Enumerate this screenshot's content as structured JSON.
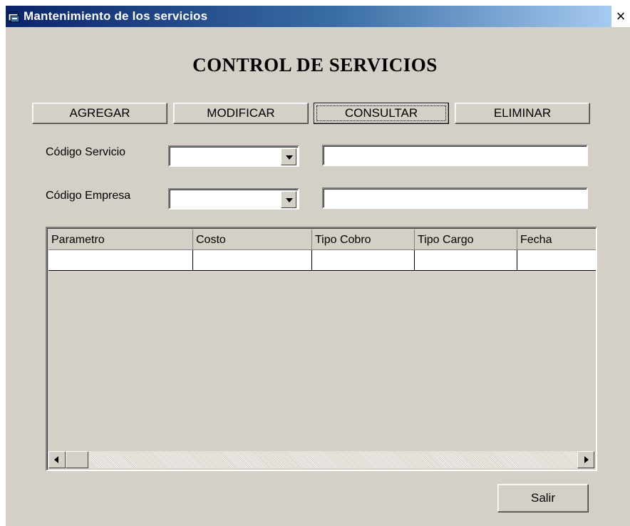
{
  "window": {
    "title": "Mantenimiento de los servicios",
    "close_glyph": "×",
    "icon": "app-window-icon"
  },
  "heading": "CONTROL DE SERVICIOS",
  "toolbar": {
    "agregar": "AGREGAR",
    "modificar": "MODIFICAR",
    "consultar": "CONSULTAR",
    "eliminar": "ELIMINAR"
  },
  "form": {
    "servicio_label": "Código Servicio",
    "empresa_label": "Código Empresa",
    "servicio_combo_value": "",
    "servicio_text_value": "",
    "empresa_combo_value": "",
    "empresa_text_value": ""
  },
  "grid": {
    "columns": [
      "Parametro",
      "Costo",
      "Tipo Cobro",
      "Tipo Cargo",
      "Fecha"
    ],
    "rows": [
      [
        "",
        "",
        "",
        "",
        ""
      ]
    ]
  },
  "footer": {
    "salir": "Salir"
  },
  "colors": {
    "face": "#d4d0c8",
    "title_start": "#0a246a",
    "title_end": "#a6caf0"
  }
}
